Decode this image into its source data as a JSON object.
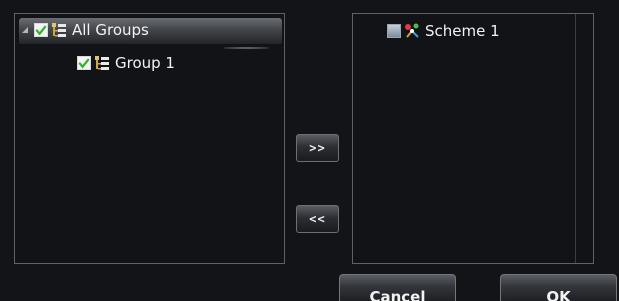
{
  "left_panel": {
    "root": {
      "label": "All Groups",
      "checked": true,
      "expanded": true
    },
    "children": [
      {
        "label": "Group 1",
        "checked": true
      }
    ]
  },
  "right_panel": {
    "items": [
      {
        "label": "Scheme 1",
        "checked": false
      }
    ]
  },
  "buttons": {
    "add_label": ">>",
    "remove_label": "<<",
    "cancel_label": "Cancel",
    "ok_label": "OK"
  },
  "icons": {
    "tree": "group-tree-icon",
    "scheme": "scheme-icon",
    "checkbox_checked": "checkmark-icon",
    "expander": "expander-triangle-icon"
  },
  "colors": {
    "background": "#121418",
    "check_green": "#2fb32f",
    "text": "#f2f2f2"
  }
}
